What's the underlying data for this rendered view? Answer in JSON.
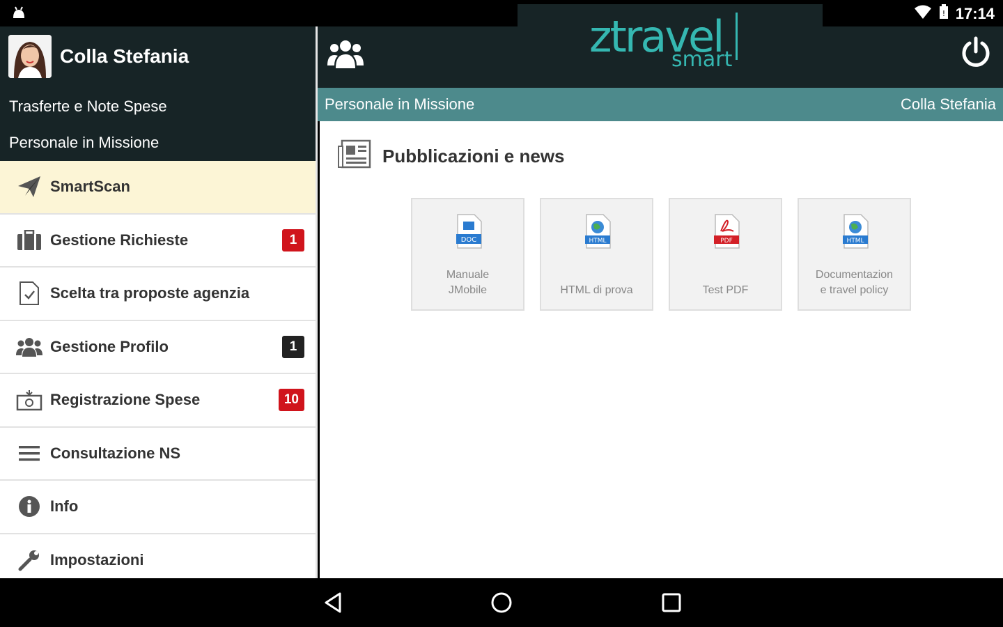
{
  "status_bar": {
    "time": "17:14"
  },
  "sidebar": {
    "user_name": "Colla Stefania",
    "subtitle_1": "Trasferte e Note Spese",
    "subtitle_2": "Personale in Missione",
    "items": [
      {
        "label": "SmartScan",
        "icon": "paper-plane-icon",
        "badge": null
      },
      {
        "label": "Gestione Richieste",
        "icon": "briefcase-icon",
        "badge": "1"
      },
      {
        "label": "Scelta tra proposte agenzia",
        "icon": "document-check-icon",
        "badge": null
      },
      {
        "label": "Gestione Profilo",
        "icon": "users-icon",
        "badge": "1"
      },
      {
        "label": "Registrazione Spese",
        "icon": "money-icon",
        "badge": "10"
      },
      {
        "label": "Consultazione NS",
        "icon": "list-icon",
        "badge": null
      },
      {
        "label": "Info",
        "icon": "info-icon",
        "badge": null
      },
      {
        "label": "Impostazioni",
        "icon": "wrench-icon",
        "badge": null
      }
    ]
  },
  "header": {
    "logo_main": "ztravel",
    "logo_sub": "smart",
    "context_left": "Personale in Missione",
    "context_right": "Colla Stefania"
  },
  "main": {
    "section_title": "Pubblicazioni e news",
    "tiles": [
      {
        "line1": "Manuale",
        "line2": "JMobile",
        "file_type": "DOC",
        "color": "#2a7bd0"
      },
      {
        "line1": "HTML di prova",
        "line2": "",
        "file_type": "HTML",
        "color": "#2a7bd0"
      },
      {
        "line1": "Test PDF",
        "line2": "",
        "file_type": "PDF",
        "color": "#d32027"
      },
      {
        "line1": "Documentazion",
        "line2": "e travel policy",
        "file_type": "HTML",
        "color": "#2a7bd0"
      }
    ]
  },
  "colors": {
    "header_bg": "#172426",
    "subbar_bg": "#4d8a8c",
    "accent": "#35b7b1",
    "active_item_bg": "#fcf5d6",
    "badge_red": "#d0141c",
    "badge_dark": "#222222"
  }
}
